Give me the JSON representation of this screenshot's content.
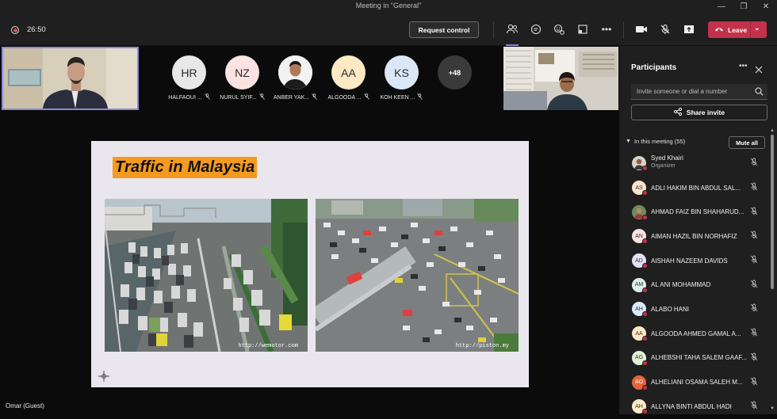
{
  "window": {
    "title": "Meeting in \"General\""
  },
  "toolbar": {
    "timer": "26:50",
    "request_control": "Request control",
    "leave": "Leave"
  },
  "roster": [
    {
      "initials": "HR",
      "name": "HALFAOUI ...",
      "color": "#e8e8e8"
    },
    {
      "initials": "NZ",
      "name": "NURUL SYIF...",
      "color": "#fde2e2"
    },
    {
      "initials": "",
      "name": "ANBER YAK...",
      "color": "#f0f0f0"
    },
    {
      "initials": "AA",
      "name": "ALGOODA ...",
      "color": "#fde9c4"
    },
    {
      "initials": "KS",
      "name": "KOH KEEN ...",
      "color": "#dbe7f7"
    }
  ],
  "more_count": "+48",
  "slide": {
    "title": "Traffic in Malaysia",
    "credit_left": "http://wemotor.com",
    "credit_right": "http://piston.my"
  },
  "caption": "Omar (Guest)",
  "panel": {
    "title": "Participants",
    "invite_placeholder": "Invite someone or dial a number",
    "share_invite": "Share invite",
    "section": "In this meeting (55)",
    "mute_all": "Mute all",
    "people": [
      {
        "initials": "",
        "name": "Syed Khairi",
        "role": "Organizer",
        "color": "#8a6e5a"
      },
      {
        "initials": "AS",
        "name": "ADLI HAKIM BIN ABDUL SAL...",
        "role": "",
        "color": "#fde2cf"
      },
      {
        "initials": "",
        "name": "AHMAD FAIZ BIN SHAHARUD...",
        "role": "",
        "color": "#7a5a4a"
      },
      {
        "initials": "AN",
        "name": "AIMAN HAZIL BIN NORHAFIZ",
        "role": "",
        "color": "#fde2e2"
      },
      {
        "initials": "AD",
        "name": "AISHAH NAZEEM DAVIDS",
        "role": "",
        "color": "#e6e0f5"
      },
      {
        "initials": "AM",
        "name": "AL ANI MOHAMMAD",
        "role": "",
        "color": "#dceee8"
      },
      {
        "initials": "AH",
        "name": "ALABO HANI",
        "role": "",
        "color": "#dbe9fb"
      },
      {
        "initials": "AA",
        "name": "ALGOODA AHMED GAMAL A...",
        "role": "",
        "color": "#fde9c4"
      },
      {
        "initials": "AG",
        "name": "ALHEBSHI TAHA SALEM GAAF...",
        "role": "",
        "color": "#e2efd9"
      },
      {
        "initials": "AO",
        "name": "ALHELIANI OSAMA SALEH M...",
        "role": "",
        "color": "#e8643a"
      },
      {
        "initials": "AH",
        "name": "ALLYNA BINTI ABDUL HADI",
        "role": "",
        "color": "#fde9c4"
      }
    ]
  }
}
